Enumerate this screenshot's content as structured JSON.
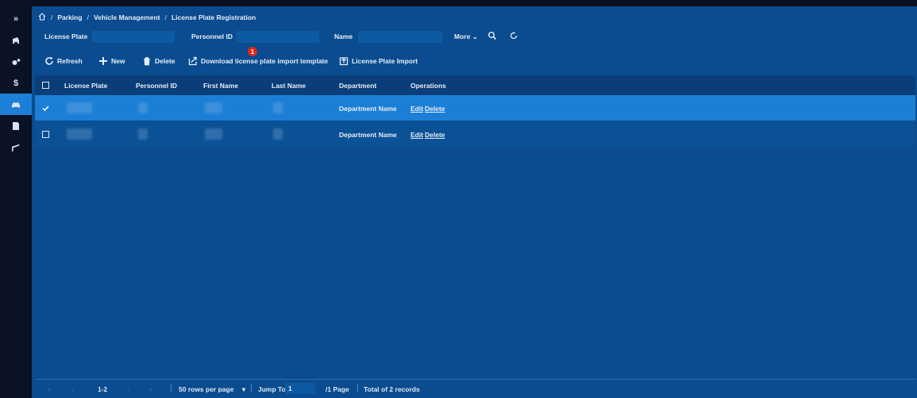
{
  "sidebar": {
    "items": [
      {
        "name": "expand-icon",
        "label": "»"
      },
      {
        "name": "parking-lot-icon"
      },
      {
        "name": "settings-icon"
      },
      {
        "name": "dollar-icon",
        "label": "$"
      },
      {
        "name": "car-icon",
        "active": true
      },
      {
        "name": "document-icon"
      },
      {
        "name": "barrier-icon"
      }
    ]
  },
  "breadcrumb": {
    "home_icon": "home-icon",
    "items": [
      "Parking",
      "Vehicle Management",
      "License Plate Registration"
    ],
    "separator": "/"
  },
  "filters": {
    "license_plate_label": "License Plate",
    "license_plate_value": "",
    "personnel_id_label": "Personnel ID",
    "personnel_id_value": "",
    "name_label": "Name",
    "name_value": "",
    "more_label": "More",
    "search_icon": "search-icon",
    "reset_icon": "reset-icon"
  },
  "toolbar": {
    "refresh_label": "Refresh",
    "new_label": "New",
    "delete_label": "Delete",
    "download_template_label": "Download license plate import template",
    "import_label": "License Plate Import"
  },
  "badge": {
    "value": "1",
    "color": "#e0281e"
  },
  "table": {
    "headers": [
      "License Plate",
      "Personnel ID",
      "First Name",
      "Last Name",
      "Department",
      "Operations"
    ],
    "rows": [
      {
        "selected": true,
        "department": "Department Name",
        "edit": "Edit",
        "delete": "Delete"
      },
      {
        "selected": false,
        "department": "Department Name",
        "edit": "Edit",
        "delete": "Delete"
      }
    ]
  },
  "footer": {
    "range": "1-2",
    "rows_per_page": "50 rows per page",
    "jump_to_label": "Jump To",
    "jump_to_value": "1",
    "page_total": "/1 Page",
    "total_records": "Total of 2 records"
  },
  "colors": {
    "main_bg": "#0a4c8f",
    "selected_row": "#1b7fd6",
    "sidebar_active": "#1d7fd8"
  }
}
